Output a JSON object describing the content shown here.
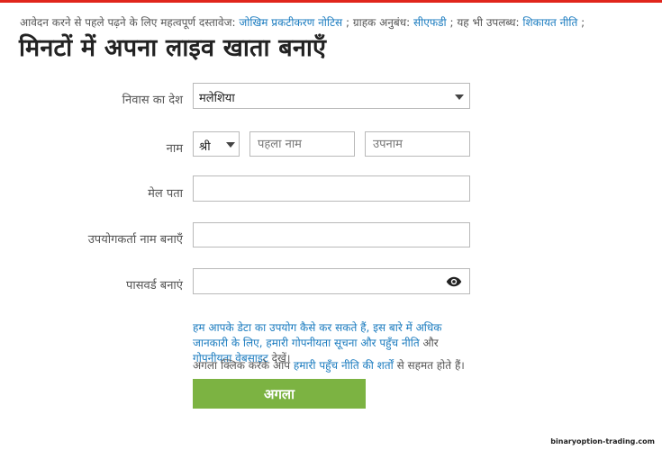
{
  "doc_notice": {
    "prefix": "आवेदन करने से पहले पढ़ने के लिए महत्वपूर्ण दस्तावेज: ",
    "risk_link": "जोखिम प्रकटीकरण नोटिस",
    "sep1": " ; ग्राहक अनुबंध: ",
    "cfd_link": "सीएफडी",
    "sep2": " ; यह भी उपलब्ध: ",
    "complaint_link": "शिकायत नीति",
    "suffix": " ;"
  },
  "title": "मिनटों में अपना लाइव खाता बनाएँ",
  "form": {
    "country_label": "निवास का देश",
    "country_value": "मलेशिया",
    "name_label": "नाम",
    "salutation_value": "श्री",
    "first_name_placeholder": "पहला नाम",
    "last_name_placeholder": "उपनाम",
    "email_label": "मेल पता",
    "email_value": "",
    "username_label": "उपयोगकर्ता नाम बनाएँ",
    "username_value": "",
    "password_label": "पासवर्ड बनाएं",
    "password_value": ""
  },
  "privacy": {
    "link1": "हम आपके डेटा का उपयोग कैसे कर सकते हैं, इस बारे में अधिक जानकारी के लिए, हमारी गोपनीयता सूचना और पहुँच नीति",
    "mid": " और ",
    "link2": "गोपनीयता वेबसाइट",
    "end": " देखें।"
  },
  "consent": {
    "prefix": "अगला क्लिक करके आप ",
    "link": "हमारी पहुँच नीति की शर्तों",
    "suffix": " से सहमत होते हैं।"
  },
  "next_button": "अगला",
  "watermark": "binaryoption-trading.com",
  "colors": {
    "accent_red": "#e0251c",
    "link_blue": "#1a7bbf",
    "button_green": "#7cb342"
  },
  "icons": {
    "password_toggle": "eye-icon",
    "dropdown": "chevron-down-icon"
  }
}
